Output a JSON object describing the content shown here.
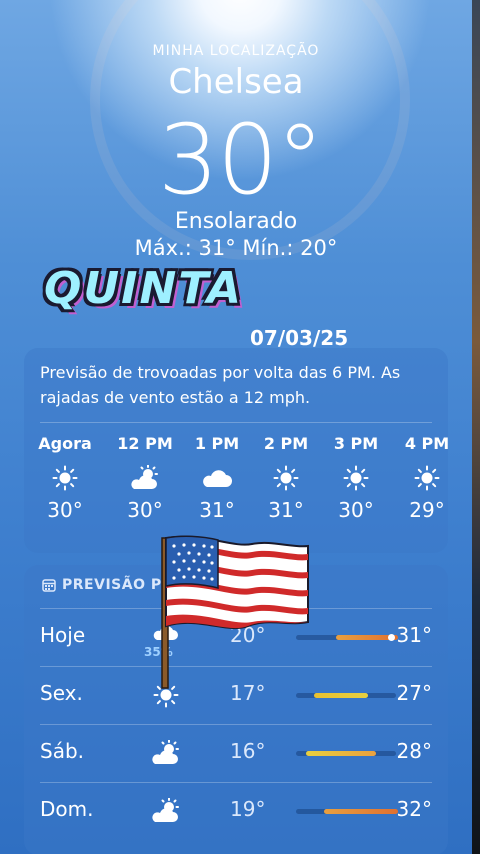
{
  "location": {
    "label": "MINHA LOCALIZAÇÃO",
    "city": "Chelsea"
  },
  "current": {
    "temp": "30°",
    "condition": "Ensolarado",
    "hilo": "Máx.: 31°  Mín.: 20°"
  },
  "stickers": {
    "day": "QUINTA",
    "date": "07/03/25"
  },
  "hourly": {
    "summary": "Previsão de trovoadas por volta das 6 PM. As rajadas de vento estão a 12 mph.",
    "items": [
      {
        "time": "Agora",
        "icon": "sun-icon",
        "temp": "30°"
      },
      {
        "time": "12 PM",
        "icon": "partly-sunny-icon",
        "temp": "30°"
      },
      {
        "time": "1 PM",
        "icon": "cloud-icon",
        "temp": "31°"
      },
      {
        "time": "2 PM",
        "icon": "sun-icon",
        "temp": "31°"
      },
      {
        "time": "3 PM",
        "icon": "sun-icon",
        "temp": "30°"
      },
      {
        "time": "4 PM",
        "icon": "sun-icon",
        "temp": "29°"
      }
    ]
  },
  "daily": {
    "header": "PREVISÃO P",
    "rows": [
      {
        "day": "Hoje",
        "icon": "rain-icon",
        "precip": "35%",
        "low": "20°",
        "high": "31°"
      },
      {
        "day": "Sex.",
        "icon": "sun-icon",
        "precip": "",
        "low": "17°",
        "high": "27°"
      },
      {
        "day": "Sáb.",
        "icon": "partly-sunny-icon",
        "precip": "",
        "low": "16°",
        "high": "28°"
      },
      {
        "day": "Dom.",
        "icon": "partly-sunny-icon",
        "precip": "",
        "low": "19°",
        "high": "32°"
      }
    ]
  },
  "colors": {
    "bar_warm": "#e8a040",
    "bar_yellow": "#e8d040",
    "bar_hot": "#e07030"
  }
}
